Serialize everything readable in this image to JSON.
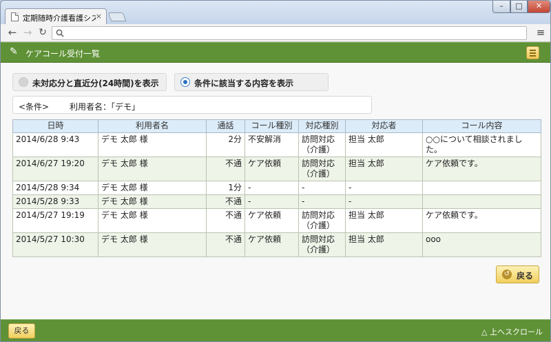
{
  "browser": {
    "tab_title": "定期随時介護看護システム",
    "tab_close": "×",
    "window_controls": {
      "minimize": "–",
      "maximize": "□",
      "close": "✕"
    },
    "nav": {
      "back": "←",
      "forward": "→",
      "reload": "↻",
      "menu": "≡"
    },
    "address": {
      "value": "",
      "search_icon": "search-icon"
    }
  },
  "header": {
    "title": "ケアコール受付一覧",
    "logo_icon": "✎"
  },
  "filters": {
    "option1": "未対応分と直近分(24時間)を表示",
    "option2": "条件に該当する内容を表示",
    "selected": 2
  },
  "condition": {
    "label": "<条件>",
    "value": "利用者名：「デモ」"
  },
  "table": {
    "headers": [
      "日時",
      "利用者名",
      "通話",
      "コール種別",
      "対応種別",
      "対応者",
      "コール内容"
    ],
    "rows": [
      [
        "2014/6/28 9:43",
        "デモ 太郎 様",
        "2分",
        "不安解消",
        "訪問対応（介護）",
        "担当 太郎",
        "○○について相談されました。"
      ],
      [
        "2014/6/27 19:20",
        "デモ 太郎 様",
        "不通",
        "ケア依頼",
        "訪問対応（介護）",
        "担当 太郎",
        "ケア依頼です。"
      ],
      [
        "2014/5/28 9:34",
        "デモ 太郎 様",
        "1分",
        "-",
        "-",
        "-",
        ""
      ],
      [
        "2014/5/28 9:33",
        "デモ 太郎 様",
        "不通",
        "-",
        "-",
        "-",
        ""
      ],
      [
        "2014/5/27 19:19",
        "デモ 太郎 様",
        "不通",
        "ケア依頼",
        "訪問対応（介護）",
        "担当 太郎",
        "ケア依頼です。"
      ],
      [
        "2014/5/27 10:30",
        "デモ 太郎 様",
        "不通",
        "ケア依頼",
        "訪問対応（介護）",
        "担当 太郎",
        "ooo"
      ]
    ]
  },
  "actions": {
    "back_label": "戻る"
  },
  "footer": {
    "back_label": "戻る",
    "scroll_top_label": "△ 上へスクロール"
  },
  "colors": {
    "brand_green": "#5f9136",
    "header_blue": "#dcecf9",
    "row_alt": "#eef4e8",
    "button_yellow": "#f0cf5c"
  }
}
